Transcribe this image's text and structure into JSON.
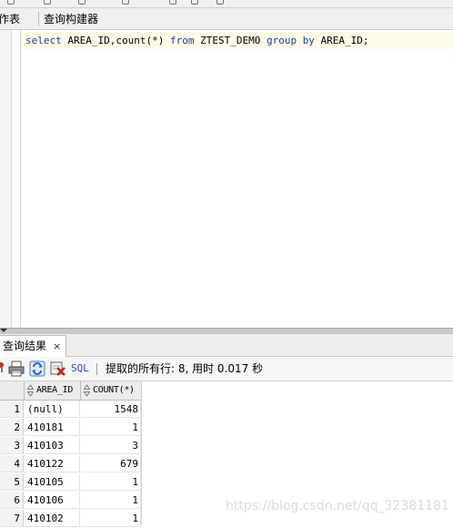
{
  "editor_tabs": {
    "worksheet_label": "作表",
    "query_builder_label": "查询构建器"
  },
  "editor": {
    "sql_tokens": [
      {
        "text": "select",
        "keyword": true
      },
      {
        "text": " AREA_ID,count(*) ",
        "keyword": false
      },
      {
        "text": "from",
        "keyword": true
      },
      {
        "text": " ZTEST_DEMO ",
        "keyword": false
      },
      {
        "text": "group by",
        "keyword": true
      },
      {
        "text": " AREA_ID;",
        "keyword": false
      }
    ]
  },
  "results_panel": {
    "tab_label": "查询结果",
    "close_glyph": "×",
    "toolbar": {
      "sql_label": "SQL",
      "separator": "|",
      "status": "提取的所有行: 8, 用时 0.017 秒"
    },
    "grid": {
      "columns": [
        "AREA_ID",
        "COUNT(*)"
      ],
      "rows": [
        {
          "num": "1",
          "area_id": "(null)",
          "count": "1548"
        },
        {
          "num": "2",
          "area_id": "410181",
          "count": "1"
        },
        {
          "num": "3",
          "area_id": "410103",
          "count": "3"
        },
        {
          "num": "4",
          "area_id": "410122",
          "count": "679"
        },
        {
          "num": "5",
          "area_id": "410105",
          "count": "1"
        },
        {
          "num": "6",
          "area_id": "410106",
          "count": "1"
        },
        {
          "num": "7",
          "area_id": "410102",
          "count": "1"
        }
      ]
    }
  },
  "watermark": "https://blog.csdn.net/qq_32381181",
  "colors": {
    "keyword": "#1a3e9b",
    "current_line": "#fdfbe8",
    "sql_link": "#2a4fb0"
  }
}
